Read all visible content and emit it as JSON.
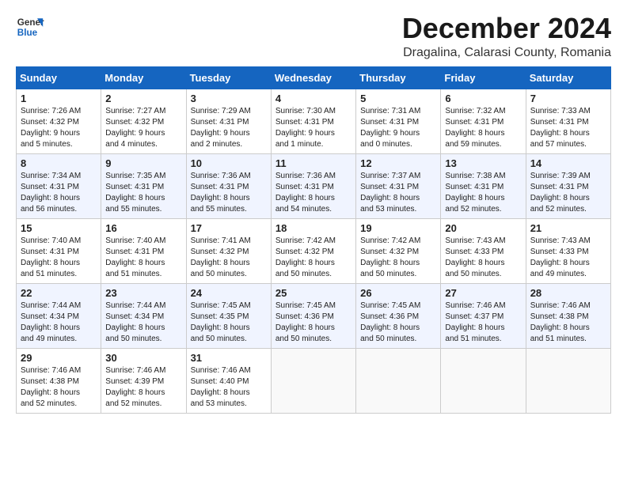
{
  "logo": {
    "line1": "General",
    "line2": "Blue"
  },
  "title": "December 2024",
  "location": "Dragalina, Calarasi County, Romania",
  "weekdays": [
    "Sunday",
    "Monday",
    "Tuesday",
    "Wednesday",
    "Thursday",
    "Friday",
    "Saturday"
  ],
  "weeks": [
    [
      {
        "day": "1",
        "info": "Sunrise: 7:26 AM\nSunset: 4:32 PM\nDaylight: 9 hours\nand 5 minutes."
      },
      {
        "day": "2",
        "info": "Sunrise: 7:27 AM\nSunset: 4:32 PM\nDaylight: 9 hours\nand 4 minutes."
      },
      {
        "day": "3",
        "info": "Sunrise: 7:29 AM\nSunset: 4:31 PM\nDaylight: 9 hours\nand 2 minutes."
      },
      {
        "day": "4",
        "info": "Sunrise: 7:30 AM\nSunset: 4:31 PM\nDaylight: 9 hours\nand 1 minute."
      },
      {
        "day": "5",
        "info": "Sunrise: 7:31 AM\nSunset: 4:31 PM\nDaylight: 9 hours\nand 0 minutes."
      },
      {
        "day": "6",
        "info": "Sunrise: 7:32 AM\nSunset: 4:31 PM\nDaylight: 8 hours\nand 59 minutes."
      },
      {
        "day": "7",
        "info": "Sunrise: 7:33 AM\nSunset: 4:31 PM\nDaylight: 8 hours\nand 57 minutes."
      }
    ],
    [
      {
        "day": "8",
        "info": "Sunrise: 7:34 AM\nSunset: 4:31 PM\nDaylight: 8 hours\nand 56 minutes."
      },
      {
        "day": "9",
        "info": "Sunrise: 7:35 AM\nSunset: 4:31 PM\nDaylight: 8 hours\nand 55 minutes."
      },
      {
        "day": "10",
        "info": "Sunrise: 7:36 AM\nSunset: 4:31 PM\nDaylight: 8 hours\nand 55 minutes."
      },
      {
        "day": "11",
        "info": "Sunrise: 7:36 AM\nSunset: 4:31 PM\nDaylight: 8 hours\nand 54 minutes."
      },
      {
        "day": "12",
        "info": "Sunrise: 7:37 AM\nSunset: 4:31 PM\nDaylight: 8 hours\nand 53 minutes."
      },
      {
        "day": "13",
        "info": "Sunrise: 7:38 AM\nSunset: 4:31 PM\nDaylight: 8 hours\nand 52 minutes."
      },
      {
        "day": "14",
        "info": "Sunrise: 7:39 AM\nSunset: 4:31 PM\nDaylight: 8 hours\nand 52 minutes."
      }
    ],
    [
      {
        "day": "15",
        "info": "Sunrise: 7:40 AM\nSunset: 4:31 PM\nDaylight: 8 hours\nand 51 minutes."
      },
      {
        "day": "16",
        "info": "Sunrise: 7:40 AM\nSunset: 4:31 PM\nDaylight: 8 hours\nand 51 minutes."
      },
      {
        "day": "17",
        "info": "Sunrise: 7:41 AM\nSunset: 4:32 PM\nDaylight: 8 hours\nand 50 minutes."
      },
      {
        "day": "18",
        "info": "Sunrise: 7:42 AM\nSunset: 4:32 PM\nDaylight: 8 hours\nand 50 minutes."
      },
      {
        "day": "19",
        "info": "Sunrise: 7:42 AM\nSunset: 4:32 PM\nDaylight: 8 hours\nand 50 minutes."
      },
      {
        "day": "20",
        "info": "Sunrise: 7:43 AM\nSunset: 4:33 PM\nDaylight: 8 hours\nand 50 minutes."
      },
      {
        "day": "21",
        "info": "Sunrise: 7:43 AM\nSunset: 4:33 PM\nDaylight: 8 hours\nand 49 minutes."
      }
    ],
    [
      {
        "day": "22",
        "info": "Sunrise: 7:44 AM\nSunset: 4:34 PM\nDaylight: 8 hours\nand 49 minutes."
      },
      {
        "day": "23",
        "info": "Sunrise: 7:44 AM\nSunset: 4:34 PM\nDaylight: 8 hours\nand 50 minutes."
      },
      {
        "day": "24",
        "info": "Sunrise: 7:45 AM\nSunset: 4:35 PM\nDaylight: 8 hours\nand 50 minutes."
      },
      {
        "day": "25",
        "info": "Sunrise: 7:45 AM\nSunset: 4:36 PM\nDaylight: 8 hours\nand 50 minutes."
      },
      {
        "day": "26",
        "info": "Sunrise: 7:45 AM\nSunset: 4:36 PM\nDaylight: 8 hours\nand 50 minutes."
      },
      {
        "day": "27",
        "info": "Sunrise: 7:46 AM\nSunset: 4:37 PM\nDaylight: 8 hours\nand 51 minutes."
      },
      {
        "day": "28",
        "info": "Sunrise: 7:46 AM\nSunset: 4:38 PM\nDaylight: 8 hours\nand 51 minutes."
      }
    ],
    [
      {
        "day": "29",
        "info": "Sunrise: 7:46 AM\nSunset: 4:38 PM\nDaylight: 8 hours\nand 52 minutes."
      },
      {
        "day": "30",
        "info": "Sunrise: 7:46 AM\nSunset: 4:39 PM\nDaylight: 8 hours\nand 52 minutes."
      },
      {
        "day": "31",
        "info": "Sunrise: 7:46 AM\nSunset: 4:40 PM\nDaylight: 8 hours\nand 53 minutes."
      },
      {
        "day": "",
        "info": ""
      },
      {
        "day": "",
        "info": ""
      },
      {
        "day": "",
        "info": ""
      },
      {
        "day": "",
        "info": ""
      }
    ]
  ]
}
